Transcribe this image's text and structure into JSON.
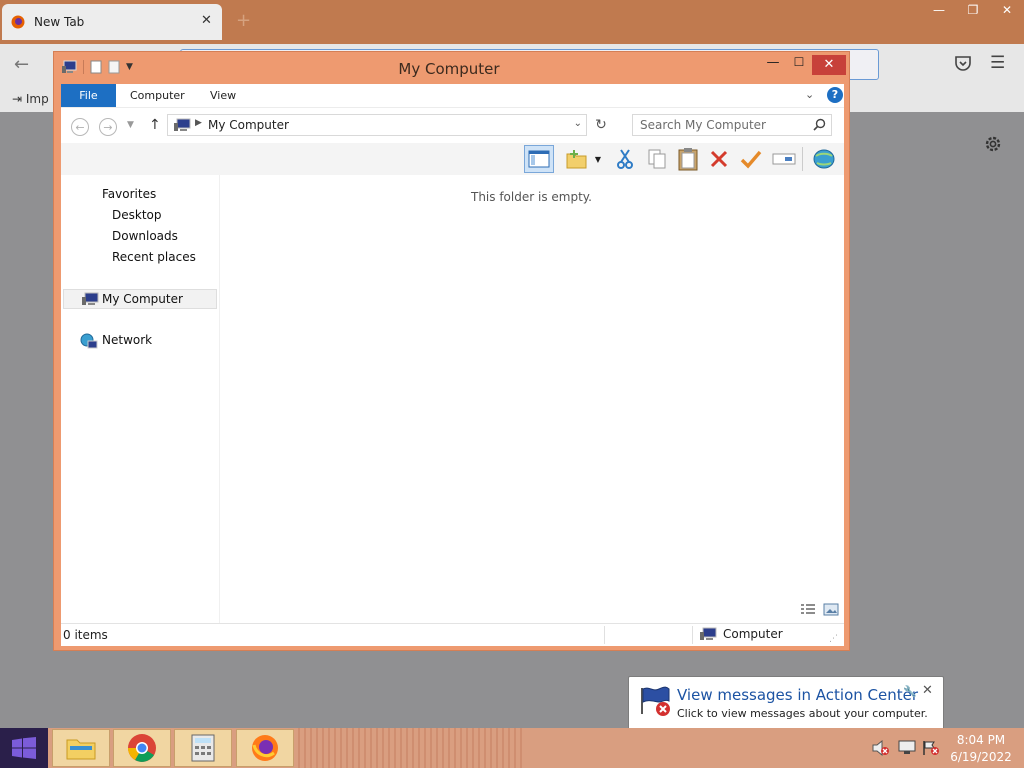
{
  "browser": {
    "tab_title": "New Tab",
    "tab_close": "✕",
    "new_tab": "+",
    "bookmark_import": "Imp",
    "window_min": "—",
    "window_restore": "❐",
    "window_close": "✕"
  },
  "explorer": {
    "title": "My Computer",
    "ribbon_tabs": [
      "File",
      "Computer",
      "View"
    ],
    "address": "My Computer",
    "search_placeholder": "Search My Computer",
    "nav_pane": {
      "favorites": "Favorites",
      "desktop": "Desktop",
      "downloads": "Downloads",
      "recent_places": "Recent places",
      "my_computer": "My Computer",
      "network": "Network"
    },
    "empty_message": "This folder is empty.",
    "status": {
      "items": "0 items",
      "location": "Computer"
    },
    "toolbar_icons": [
      "layout-pane-icon",
      "new-folder-icon",
      "cut-icon",
      "copy-icon",
      "paste-icon",
      "delete-icon",
      "properties-check-icon",
      "rename-icon",
      "globe-icon"
    ]
  },
  "notification": {
    "title": "View messages in Action Center",
    "body": "Click to view messages about your computer."
  },
  "taskbar": {
    "apps": [
      "file-explorer",
      "chrome",
      "calculator",
      "firefox"
    ],
    "time": "8:04 PM",
    "date": "6/19/2022"
  },
  "colors": {
    "window_frame": "#ee9a70",
    "file_tab": "#1d6fc3",
    "close_button": "#c7413a",
    "taskbar": "#d99e80",
    "notification_title": "#1c53a3"
  }
}
